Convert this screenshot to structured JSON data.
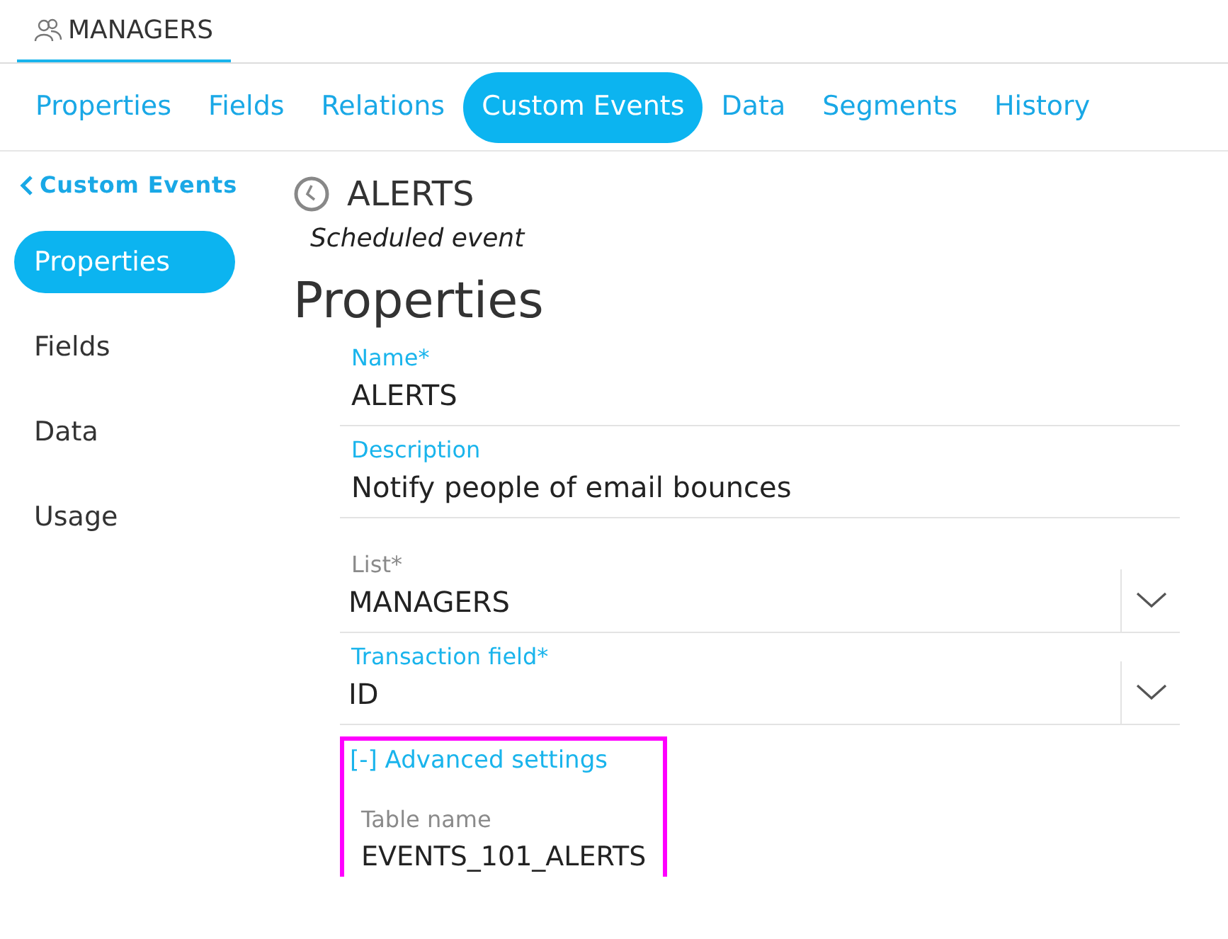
{
  "object_tab": {
    "label": "MANAGERS",
    "selected": true
  },
  "tabs": [
    {
      "label": "Properties",
      "selected": false
    },
    {
      "label": "Fields",
      "selected": false
    },
    {
      "label": "Relations",
      "selected": false
    },
    {
      "label": "Custom Events",
      "selected": true
    },
    {
      "label": "Data",
      "selected": false
    },
    {
      "label": "Segments",
      "selected": false
    },
    {
      "label": "History",
      "selected": false
    }
  ],
  "back_link": "Custom Events",
  "sidebar": {
    "items": [
      {
        "label": "Properties",
        "selected": true
      },
      {
        "label": "Fields",
        "selected": false
      },
      {
        "label": "Data",
        "selected": false
      },
      {
        "label": "Usage",
        "selected": false
      }
    ]
  },
  "event": {
    "title": "ALERTS",
    "subtitle": "Scheduled event"
  },
  "heading": "Properties",
  "fields": [
    {
      "kind": "text",
      "label": "Name*",
      "value": "ALERTS",
      "disabled": false
    },
    {
      "kind": "text",
      "label": "Description",
      "value": "Notify people of email bounces",
      "disabled": false
    },
    {
      "kind": "select",
      "label": "List*",
      "value": "MANAGERS",
      "disabled": true
    },
    {
      "kind": "select",
      "label": "Transaction field*",
      "value": "ID",
      "disabled": false
    }
  ],
  "advanced": {
    "toggle": "[-] Advanced settings",
    "highlighted": true,
    "fields": [
      {
        "label": "Table name",
        "value": "EVENTS_101_ALERTS",
        "disabled": true
      }
    ]
  }
}
